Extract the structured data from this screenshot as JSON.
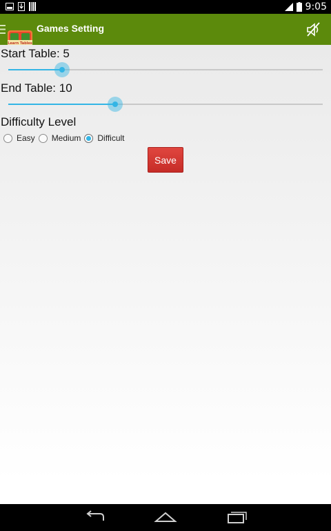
{
  "status_bar": {
    "time": "9:05",
    "left_icons": [
      "image-icon",
      "download-icon",
      "barcode-icon"
    ],
    "right_icons": [
      "signal-icon",
      "battery-icon"
    ]
  },
  "action_bar": {
    "title": "Games Setting",
    "logo_text": "Learn Tables",
    "background_color": "#5c8a0c",
    "action_icon": "mute-icon"
  },
  "settings": {
    "start_table": {
      "label": "Start Table: 5",
      "value": 5,
      "fill_fraction": 0.17
    },
    "end_table": {
      "label": "End Table: 10",
      "value": 10,
      "fill_fraction": 0.34
    },
    "difficulty": {
      "label": "Difficulty Level",
      "options": [
        "Easy",
        "Medium",
        "Difficult"
      ],
      "selected": "Difficult"
    },
    "save_label": "Save",
    "accent_color": "#33b5e5",
    "save_color": "#d13a34"
  },
  "nav_bar": {
    "buttons": [
      "back-icon",
      "home-icon",
      "recent-apps-icon"
    ]
  }
}
